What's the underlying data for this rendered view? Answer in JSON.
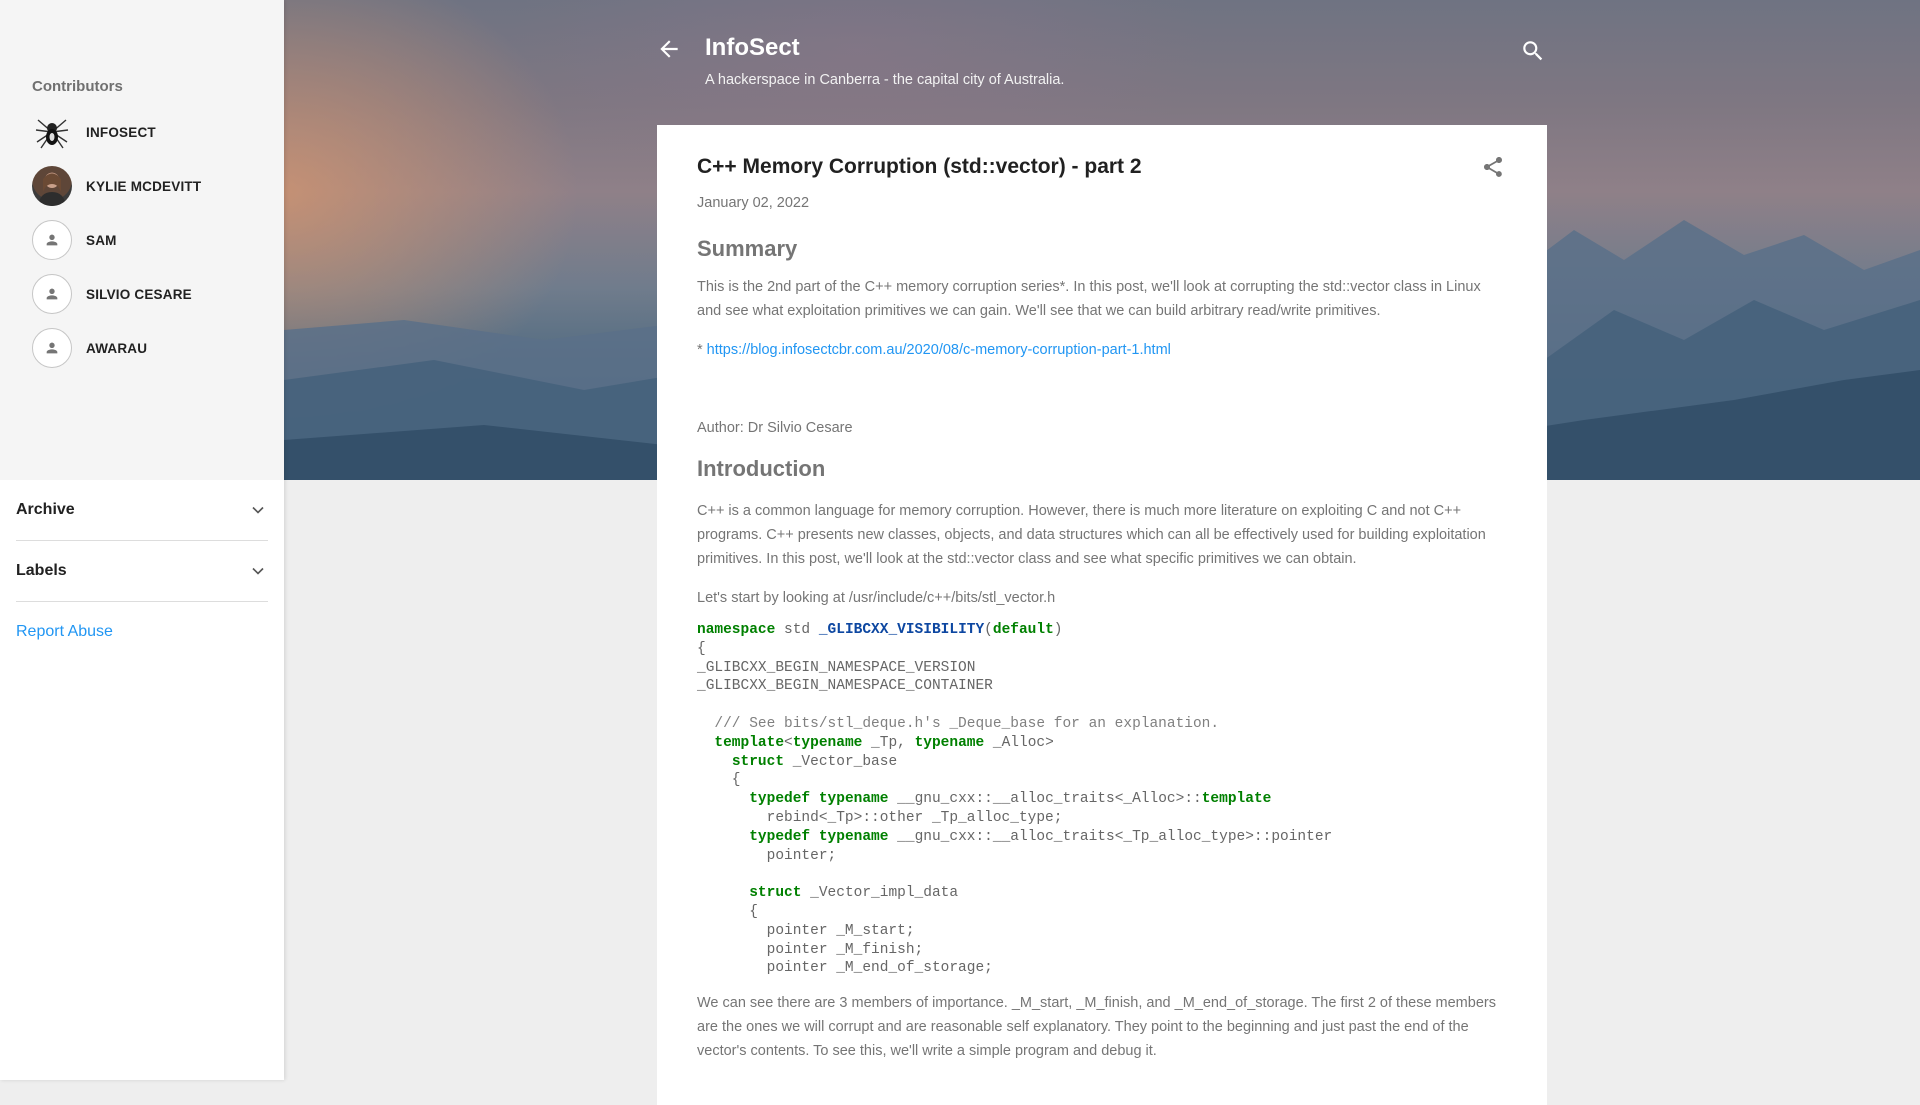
{
  "blog": {
    "title": "InfoSect",
    "description": "A hackerspace in Canberra - the capital city of Australia."
  },
  "sidebar": {
    "contributors_title": "Contributors",
    "contributors": [
      {
        "name": "INFOSECT",
        "avatar": "spider-logo-icon"
      },
      {
        "name": "KYLIE MCDEVITT",
        "avatar": "profile-photo"
      },
      {
        "name": "SAM",
        "avatar": "default-person-icon"
      },
      {
        "name": "SILVIO CESARE",
        "avatar": "default-person-icon"
      },
      {
        "name": "AWARAU",
        "avatar": "default-person-icon"
      }
    ],
    "archive_label": "Archive",
    "labels_label": "Labels",
    "report_abuse": "Report Abuse"
  },
  "post": {
    "title": "C++ Memory Corruption (std::vector) - part 2",
    "date": "January 02, 2022",
    "summary_heading": "Summary",
    "summary_text": "This is the 2nd part of the C++ memory corruption series*. In this post, we'll look at corrupting the std::vector class in Linux and see what exploitation primitives we can gain. We'll see that we can build arbitrary read/write primitives.",
    "link_prefix": "* ",
    "link_text": "https://blog.infosectcbr.com.au/2020/08/c-memory-corruption-part-1.html",
    "author": "Author: Dr Silvio Cesare",
    "intro_heading": "Introduction",
    "intro_text": "C++ is a common language for memory corruption. However, there is much more literature on exploiting C and not C++ programs. C++ presents new classes, objects, and data structures which can all be effectively used for building exploitation primitives.  In this post, we'll look at the std::vector class and see what specific primitives we can obtain.",
    "start_text": "Let's start by looking at /usr/include/c++/bits/stl_vector.h",
    "after_code_text": "We can see there are 3 members of importance. _M_start, _M_finish, and _M_end_of_storage.  The first 2 of these members are the ones we will corrupt and are reasonable self explanatory. They point to the beginning and just past the end of the vector's contents. To see this, we'll write a simple program and debug it.",
    "code": {
      "l1_kw": "namespace",
      "l1_id": " std ",
      "l1_macro": "_GLIBCXX_VISIBILITY",
      "l1_p1": "(",
      "l1_kw2": "default",
      "l1_p2": ")",
      "l2": "{",
      "l3": "_GLIBCXX_BEGIN_NAMESPACE_VERSION",
      "l4": "_GLIBCXX_BEGIN_NAMESPACE_CONTAINER",
      "l6_comment": "  /// See bits/stl_deque.h's _Deque_base for an explanation.",
      "l7_indent": "  ",
      "l7_kw1": "template",
      "l7_p1": "<",
      "l7_kw2": "typename",
      "l7_a": " _Tp, ",
      "l7_kw3": "typename",
      "l7_b": " _Alloc>",
      "l8_indent": "    ",
      "l8_kw": "struct",
      "l8_id": " _Vector_base",
      "l9": "    {",
      "l10_indent": "      ",
      "l10_kw1": "typedef",
      "l10_sp": " ",
      "l10_kw2": "typename",
      "l10_a": " __gnu_cxx::__alloc_traits<_Alloc>::",
      "l10_kw3": "template",
      "l11": "        rebind<_Tp>::other _Tp_alloc_type;",
      "l12_indent": "      ",
      "l12_kw1": "typedef",
      "l12_sp": " ",
      "l12_kw2": "typename",
      "l12_a": " __gnu_cxx::__alloc_traits<_Tp_alloc_type>::pointer",
      "l13": "        pointer;",
      "l15_indent": "      ",
      "l15_kw": "struct",
      "l15_id": " _Vector_impl_data",
      "l16": "      {",
      "l17": "        pointer _M_start;",
      "l18": "        pointer _M_finish;",
      "l19": "        pointer _M_end_of_storage;"
    }
  },
  "colors": {
    "accent_link": "#2196f3",
    "code_keyword": "#008000",
    "code_macro": "#0d47a1",
    "title_text": "#212121",
    "body_text": "#757575"
  }
}
